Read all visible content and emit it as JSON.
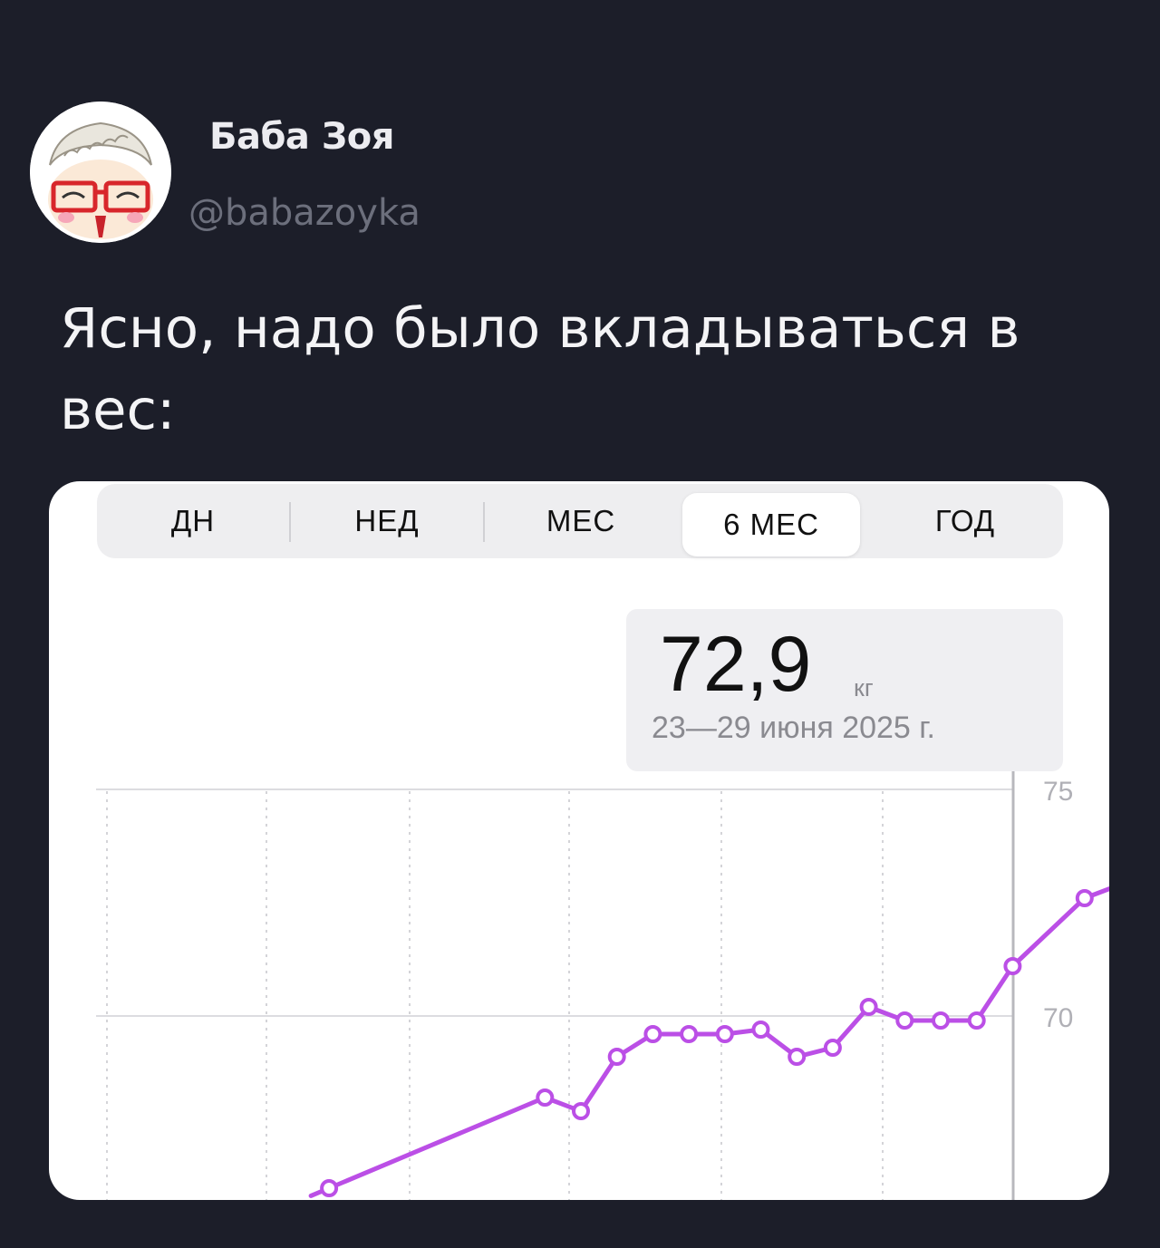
{
  "author": {
    "name": "Баба Зоя",
    "handle": "@babazoyka"
  },
  "tweet": {
    "text": "Ясно, надо было вкладываться в вес:"
  },
  "app": {
    "tabs": [
      {
        "label": "ДН",
        "active": false
      },
      {
        "label": "НЕД",
        "active": false
      },
      {
        "label": "МЕС",
        "active": false
      },
      {
        "label": "6 МЕС",
        "active": true
      },
      {
        "label": "ГОД",
        "active": false
      }
    ],
    "tooltip": {
      "value": "72,9",
      "unit": "кг",
      "date": "23—29 июня 2025 г."
    }
  },
  "colors": {
    "background": "#1c1e29",
    "line": "#bb4fe6",
    "card": "#ffffff"
  },
  "chart_data": {
    "type": "line",
    "ylim": [
      66,
      75
    ],
    "ytick_labels": [
      "75",
      "70"
    ],
    "grid": true,
    "series": [
      {
        "values": [
          66.2,
          68.2,
          67.9,
          69.1,
          69.6,
          69.6,
          69.6,
          69.7,
          69.1,
          69.3,
          70.2,
          69.9,
          69.9,
          69.9,
          71.1,
          72.6,
          72.9
        ]
      }
    ],
    "point_slots": [
      3,
      9,
      10,
      11,
      12,
      13,
      14,
      15,
      16,
      17,
      18,
      19,
      20,
      21,
      22,
      24,
      25
    ]
  }
}
